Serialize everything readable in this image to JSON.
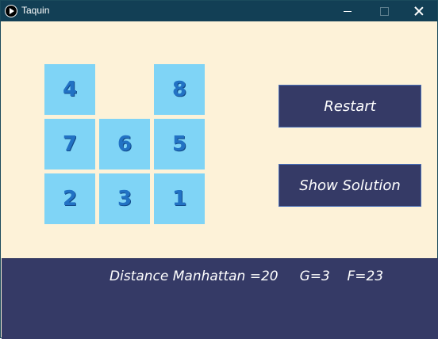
{
  "window": {
    "title": "Taquin"
  },
  "board": {
    "tiles": [
      {
        "value": "4"
      },
      {
        "value": ""
      },
      {
        "value": "8"
      },
      {
        "value": "7"
      },
      {
        "value": "6"
      },
      {
        "value": "5"
      },
      {
        "value": "2"
      },
      {
        "value": "3"
      },
      {
        "value": "1"
      }
    ]
  },
  "buttons": {
    "restart": "Restart",
    "show_solution": "Show Solution"
  },
  "status": {
    "manhattan": "Distance Manhattan =20",
    "g": "G=3",
    "f": "F=23"
  },
  "colors": {
    "tile": "#7fd4f6",
    "tile_text": "#2272c4",
    "background": "#fdf2d8",
    "panel": "#353a66",
    "titlebar": "#123f55"
  }
}
